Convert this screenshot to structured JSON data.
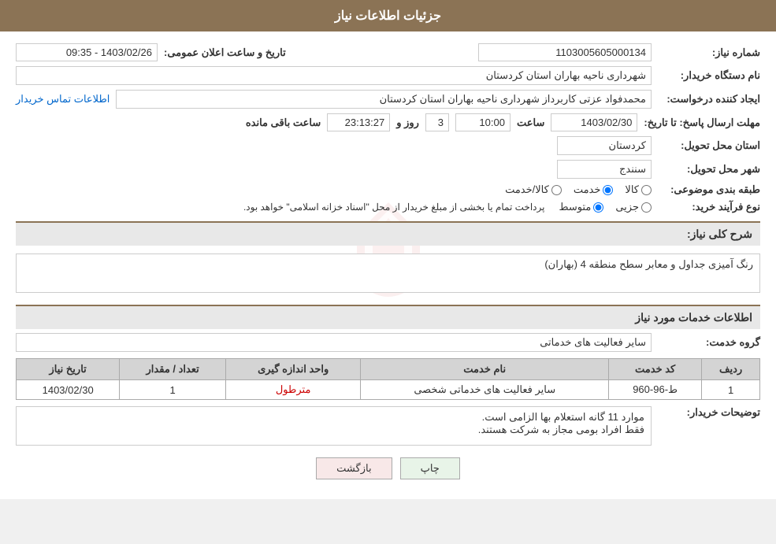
{
  "header": {
    "title": "جزئیات اطلاعات نیاز"
  },
  "fields": {
    "need_number_label": "شماره نیاز:",
    "need_number_value": "1103005605000134",
    "announcement_date_label": "تاریخ و ساعت اعلان عمومی:",
    "announcement_date_value": "1403/02/26 - 09:35",
    "buyer_org_label": "نام دستگاه خریدار:",
    "buyer_org_value": "شهرداری ناحیه بهاران استان کردستان",
    "requester_label": "ایجاد کننده درخواست:",
    "requester_value": "محمدفواد عزتی کاربرداز شهرداری ناحیه بهاران استان کردستان",
    "contact_link": "اطلاعات تماس خریدار",
    "response_deadline_label": "مهلت ارسال پاسخ: تا تاریخ:",
    "response_date": "1403/02/30",
    "response_time_label": "ساعت",
    "response_time": "10:00",
    "response_day_label": "روز و",
    "response_days": "3",
    "response_remaining_label": "ساعت باقی مانده",
    "response_remaining": "23:13:27",
    "delivery_province_label": "استان محل تحویل:",
    "delivery_province": "کردستان",
    "delivery_city_label": "شهر محل تحویل:",
    "delivery_city": "سنندج",
    "category_label": "طبقه بندی موضوعی:",
    "category_options": [
      "کالا",
      "خدمت",
      "کالا/خدمت"
    ],
    "category_selected": "خدمت",
    "process_label": "نوع فرآیند خرید:",
    "process_options": [
      "جزیی",
      "متوسط"
    ],
    "process_selected": "متوسط",
    "process_note": "پرداخت تمام یا بخشی از مبلغ خریدار از محل \"اسناد خزانه اسلامی\" خواهد بود.",
    "need_description_label": "شرح کلی نیاز:",
    "need_description": "رنگ آمیزی جداول و معابر سطح منطقه 4 (بهاران)",
    "services_info_label": "اطلاعات خدمات مورد نیاز",
    "service_group_label": "گروه خدمت:",
    "service_group_value": "سایر فعالیت های خدماتی",
    "table": {
      "headers": [
        "ردیف",
        "کد خدمت",
        "نام خدمت",
        "واحد اندازه گیری",
        "تعداد / مقدار",
        "تاریخ نیاز"
      ],
      "rows": [
        {
          "row": "1",
          "code": "ط-96-960",
          "name": "سایر فعالیت های خدماتی شخصی",
          "unit": "مترطول",
          "quantity": "1",
          "date": "1403/02/30"
        }
      ]
    },
    "buyer_notes_label": "توضیحات خریدار:",
    "buyer_notes_line1": "موارد 11 گانه استعلام بها الزامی است.",
    "buyer_notes_line2": "فقط افراد بومی مجاز به شرکت هستند."
  },
  "buttons": {
    "print": "چاپ",
    "back": "بازگشت"
  }
}
